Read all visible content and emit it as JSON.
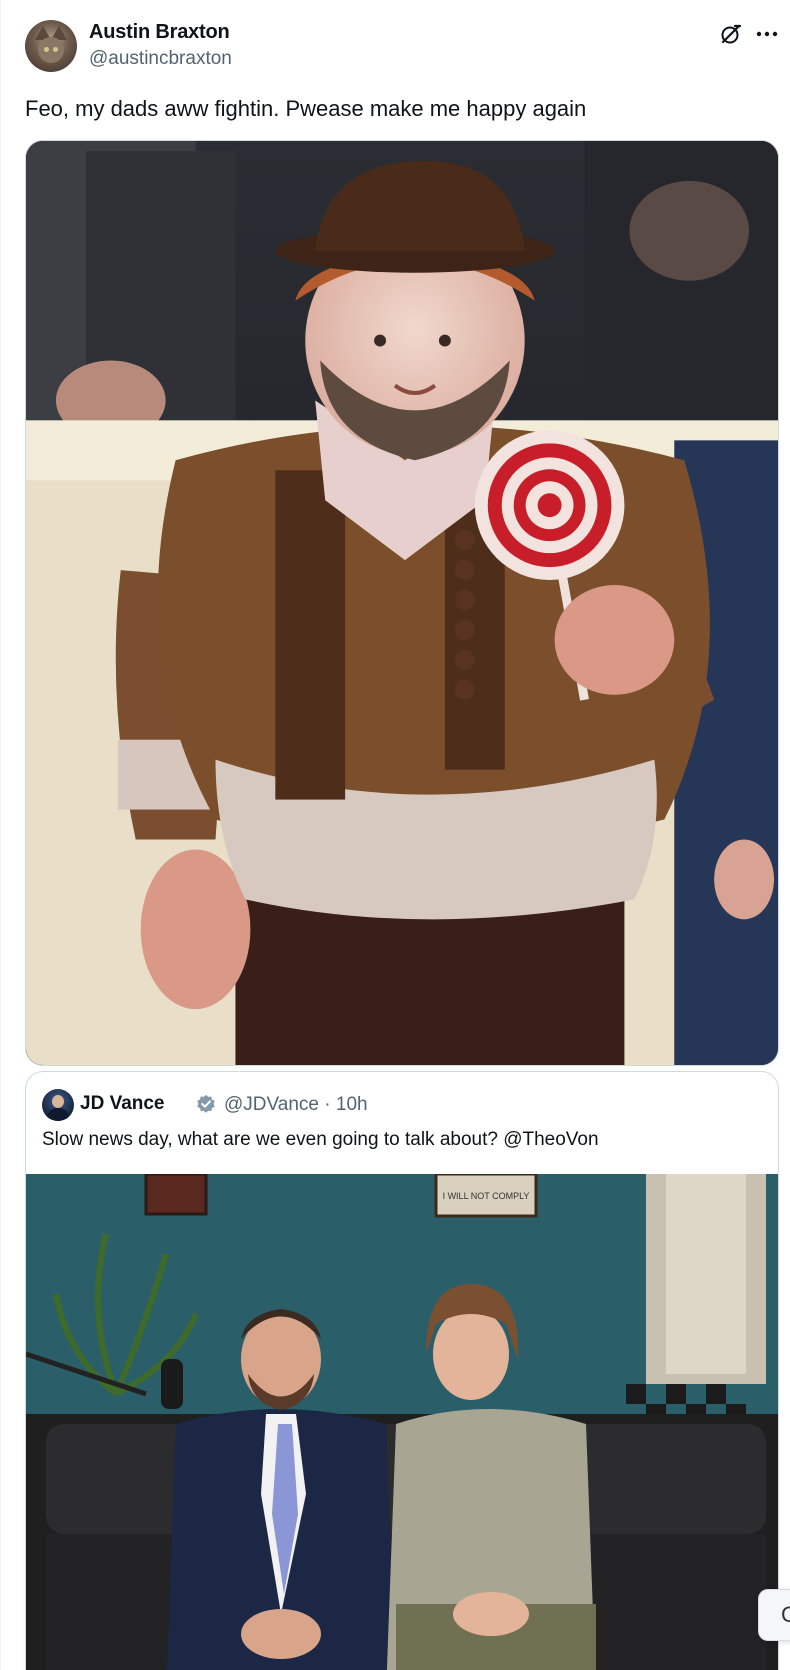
{
  "post": {
    "author_name": "Austin Braxton",
    "author_handle": "@austincbraxton",
    "text": "Feo, my dads aww fightin. Pwease make me happy again",
    "media_alt": "Edited photo of a stout man in a brown vest costume holding a red-and-white swirl lollipop"
  },
  "quoted_post": {
    "author_name": "JD Vance",
    "author_handle": "@JDVance",
    "separator": "·",
    "time": "10h",
    "text": "Slow news day, what are we even going to talk about? @TheoVon",
    "media_alt": "Two men seated on a black leather couch in a studio with teal walls"
  },
  "studio_sign": "I WILL NOT COMPLY",
  "floating_button_glyph": "C",
  "icons": {
    "grok": "grok-icon",
    "more": "more-icon",
    "verified": "verified-badge-icon"
  },
  "colors": {
    "text": "#0f1419",
    "secondary": "#536471",
    "border": "#cfd9de",
    "verified_badge": "#829aab"
  }
}
